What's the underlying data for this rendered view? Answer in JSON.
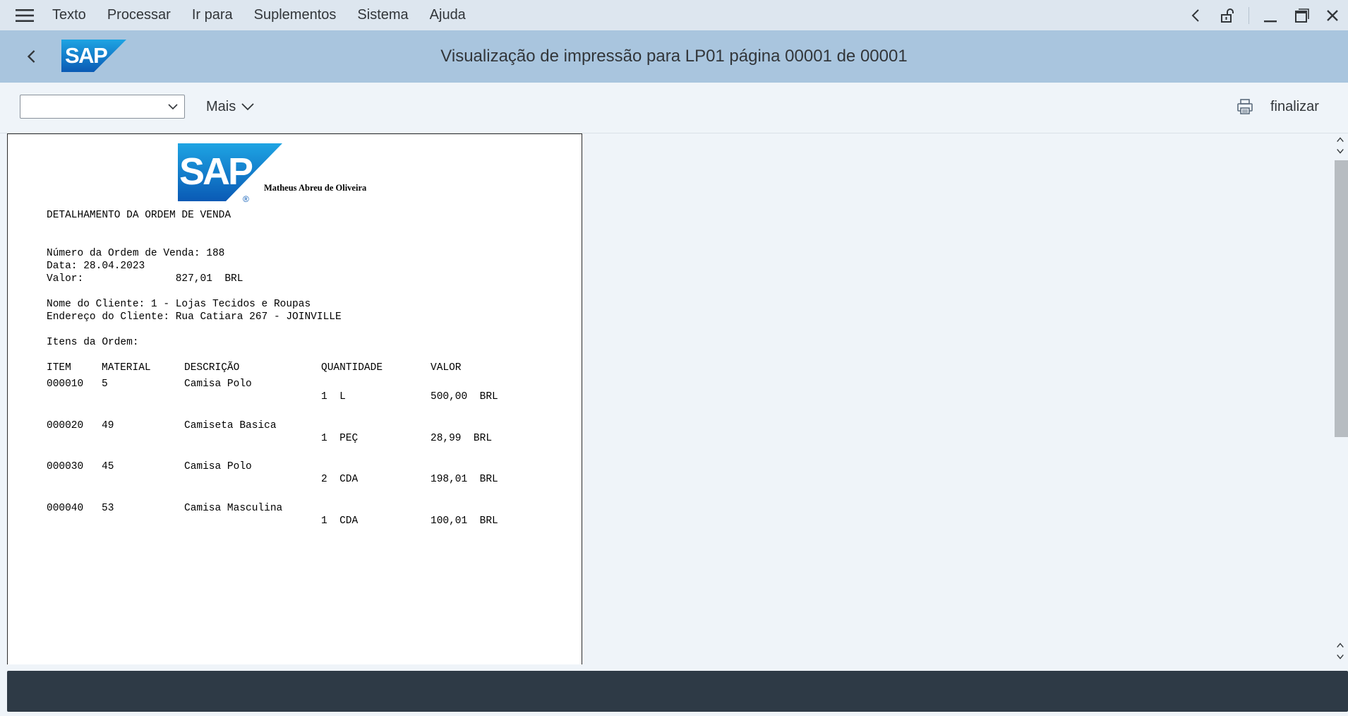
{
  "menu": {
    "items": [
      "Texto",
      "Processar",
      "Ir para",
      "Suplementos",
      "Sistema",
      "Ajuda"
    ]
  },
  "title": "Visualização de impressão para LP01 página 00001 de 00001",
  "toolbar": {
    "dropdown_value": "",
    "more_label": "Mais",
    "finish_label": "finalizar"
  },
  "document": {
    "author": "Matheus Abreu de Oliveira",
    "heading": "DETALHAMENTO DA ORDEM DE VENDA",
    "order_line": "Número da Ordem de Venda: 188",
    "date_line": "Data: 28.04.2023",
    "value_line": "Valor:               827,01  BRL",
    "customer_line": "Nome do Cliente: 1 - Lojas Tecidos e Roupas",
    "address_line": "Endereço do Cliente: Rua Catiara 267 - JOINVILLE",
    "items_label": "Itens da Ordem:",
    "columns": [
      "ITEM",
      "MATERIAL",
      "DESCRIÇÃO",
      "QUANTIDADE",
      "VALOR"
    ],
    "rows": [
      {
        "item": "000010",
        "material": "5",
        "description": "Camisa Polo",
        "quantity": "1  L",
        "value": "500,00  BRL"
      },
      {
        "item": "000020",
        "material": "49",
        "description": "Camiseta Basica",
        "quantity": "1  PEÇ",
        "value": "28,99  BRL"
      },
      {
        "item": "000030",
        "material": "45",
        "description": "Camisa Polo",
        "quantity": "2  CDA",
        "value": "198,01  BRL"
      },
      {
        "item": "000040",
        "material": "53",
        "description": "Camisa Masculina",
        "quantity": "1  CDA",
        "value": "100,01  BRL"
      }
    ]
  },
  "logos": {
    "sap_text": "SAP",
    "registered_mark": "®"
  },
  "colors": {
    "menubar_bg": "#dde6ef",
    "titlebar_bg": "#a9c5de",
    "statusbar_bg": "#2e3a46",
    "sap_blue_start": "#1ea4e3",
    "sap_blue_end": "#0a5ab5"
  }
}
